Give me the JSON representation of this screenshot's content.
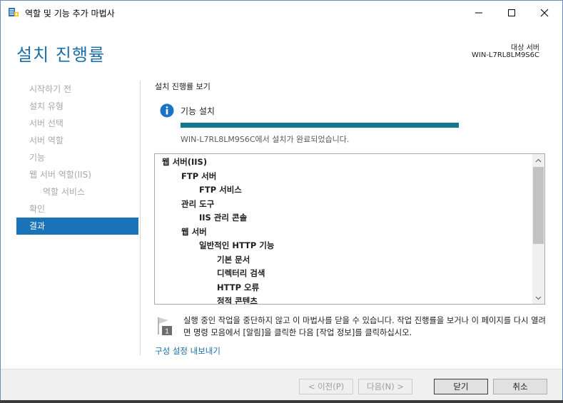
{
  "window": {
    "title": "역할 및 기능 추가 마법사",
    "app_icon": "server-manager-icon"
  },
  "header": {
    "page_title": "설치 진행률",
    "target_label": "대상 서버",
    "target_name": "WIN-L7RL8LM9S6C"
  },
  "sidebar": {
    "items": [
      {
        "label": "시작하기 전"
      },
      {
        "label": "설치 유형"
      },
      {
        "label": "서버 선택"
      },
      {
        "label": "서버 역할"
      },
      {
        "label": "기능"
      },
      {
        "label": "웹 서버 역할(IIS)"
      },
      {
        "label": "역할 서비스"
      },
      {
        "label": "확인"
      },
      {
        "label": "결과"
      }
    ],
    "active_index": 8
  },
  "main": {
    "section_title": "설치 진행률 보기",
    "feature_install_label": "기능 설치",
    "progress_percent": 100,
    "progress_color": "#0f7a8c",
    "status_text": "WIN-L7RL8LM9S6C에서 설치가 완료되었습니다.",
    "results": [
      {
        "label": "웹 서버(IIS)",
        "level": 0
      },
      {
        "label": "FTP 서버",
        "level": 1
      },
      {
        "label": "FTP 서비스",
        "level": 2
      },
      {
        "label": "관리 도구",
        "level": 1
      },
      {
        "label": "IIS 관리 콘솔",
        "level": 2
      },
      {
        "label": "웹 서버",
        "level": 1
      },
      {
        "label": "일반적인 HTTP 기능",
        "level": 2
      },
      {
        "label": "기본 문서",
        "level": 3
      },
      {
        "label": "디렉터리 검색",
        "level": 3
      },
      {
        "label": "HTTP 오류",
        "level": 3
      },
      {
        "label": "정적 콘텐츠",
        "level": 3
      }
    ],
    "note_text": "실행 중인 작업을 중단하지 않고 이 마법사를 닫을 수 있습니다. 작업 진행률을 보거나 이 페이지를 다시 열려면 명령 모음에서 [알림]을 클릭한 다음 [작업 정보]를 클릭하십시오.",
    "export_link": "구성 설정 내보내기"
  },
  "footer": {
    "prev_label": "< 이전(P)",
    "next_label": "다음(N) >",
    "close_label": "닫기",
    "cancel_label": "취소"
  },
  "colors": {
    "accent": "#1a73b8",
    "heading": "#1a6ea8"
  }
}
